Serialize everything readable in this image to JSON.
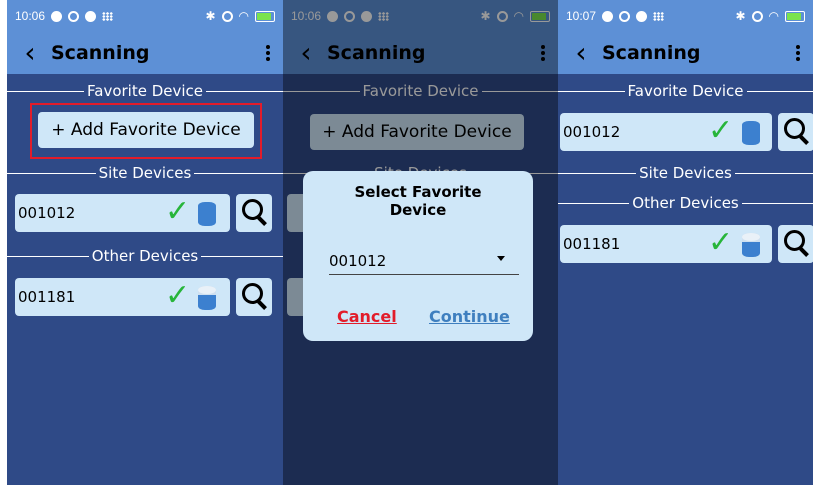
{
  "screens": [
    {
      "status": {
        "time": "10:06"
      },
      "title": "Scanning",
      "favorite_section": "Favorite Device",
      "add_favorite_label": "+ Add Favorite Device",
      "site_section": "Site Devices",
      "site_devices": [
        {
          "id": "001012",
          "fill": "full"
        }
      ],
      "other_section": "Other Devices",
      "other_devices": [
        {
          "id": "001181",
          "fill": "partial"
        }
      ]
    },
    {
      "status": {
        "time": "10:06"
      },
      "title": "Scanning",
      "favorite_section": "Favorite Device",
      "add_favorite_label": "+ Add Favorite Device",
      "site_section": "Site Devices",
      "dialog": {
        "title": "Select Favorite Device",
        "selected": "001012",
        "cancel_label": "Cancel",
        "continue_label": "Continue"
      }
    },
    {
      "status": {
        "time": "10:07"
      },
      "title": "Scanning",
      "favorite_section": "Favorite Device",
      "favorite_devices": [
        {
          "id": "001012",
          "fill": "full"
        }
      ],
      "site_section": "Site Devices",
      "other_section": "Other Devices",
      "other_devices": [
        {
          "id": "001181",
          "fill": "partial"
        }
      ]
    }
  ],
  "colors": {
    "background": "#2f4a87",
    "appbar": "#5d90d6",
    "card": "#cfe7f8",
    "check": "#27b53a",
    "tank": "#3c80cf",
    "cancel": "#e21c2a",
    "continue": "#3f7fbf",
    "highlight": "#e21c2a"
  },
  "icons": [
    "back-arrow-icon",
    "overflow-menu-icon",
    "checkmark-icon",
    "tank-icon",
    "search-icon",
    "dropdown-caret-icon"
  ]
}
